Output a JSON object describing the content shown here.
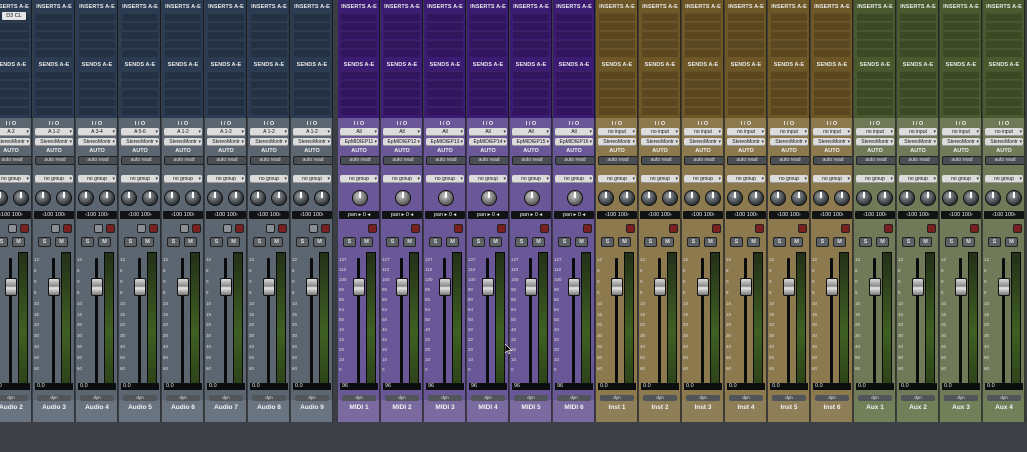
{
  "labels": {
    "inserts": "INSERTS A-E",
    "sends": "SENDS A-E",
    "io": "I / O",
    "auto": "AUTO",
    "auto_read": "auto read",
    "no_group": "no group",
    "solo": "S",
    "mute": "M",
    "pan_audio": "‹100 100›",
    "pan_midi": "pan ▸ 0 ◂",
    "no_input": "no input",
    "stereo_output": "StereoMontr",
    "dyn": "dyn",
    "selected_insert": "D3 CL"
  },
  "groups": [
    {
      "type": "audio",
      "color": "#2b3c52"
    },
    {
      "type": "midi",
      "color": "#3d1b72"
    },
    {
      "type": "inst",
      "color": "#6e5727"
    },
    {
      "type": "aux",
      "color": "#4a5a2e"
    }
  ],
  "strips": [
    {
      "name": "Audio 2",
      "type": "audio",
      "input": "A 2",
      "volume": "0.0"
    },
    {
      "name": "Audio 3",
      "type": "audio",
      "input": "A 1-2",
      "volume": "0.0"
    },
    {
      "name": "Audio 4",
      "type": "audio",
      "input": "A 3-4",
      "volume": "0.0"
    },
    {
      "name": "Audio 5",
      "type": "audio",
      "input": "A 5-6",
      "volume": "0.0"
    },
    {
      "name": "Audio 6",
      "type": "audio",
      "input": "A 1-2",
      "volume": "0.0"
    },
    {
      "name": "Audio 7",
      "type": "audio",
      "input": "A 1-2",
      "volume": "0.0"
    },
    {
      "name": "Audio 8",
      "type": "audio",
      "input": "A 1-2",
      "volume": "0.0"
    },
    {
      "name": "Audio 9",
      "type": "audio",
      "input": "A 1-2",
      "volume": "0.0"
    },
    {
      "name": "MIDI 1",
      "type": "midi",
      "input": "All",
      "output": "EpMIDIEP11",
      "volume": "96"
    },
    {
      "name": "MIDI 2",
      "type": "midi",
      "input": "All",
      "output": "EpMIDIEP12",
      "volume": "96"
    },
    {
      "name": "MIDI 3",
      "type": "midi",
      "input": "All",
      "output": "EpMIDIEP13",
      "volume": "96"
    },
    {
      "name": "MIDI 4",
      "type": "midi",
      "input": "All",
      "output": "EpMIDIEP14",
      "volume": "96"
    },
    {
      "name": "MIDI 5",
      "type": "midi",
      "input": "All",
      "output": "EpMIDIEP15",
      "volume": "96"
    },
    {
      "name": "MIDI 6",
      "type": "midi",
      "input": "All",
      "output": "EpMIDIEP16",
      "volume": "96"
    },
    {
      "name": "Inst 1",
      "type": "inst",
      "input": "no input",
      "volume": "0.0"
    },
    {
      "name": "Inst 2",
      "type": "inst",
      "input": "no input",
      "volume": "0.0"
    },
    {
      "name": "Inst 3",
      "type": "inst",
      "input": "no input",
      "volume": "0.0"
    },
    {
      "name": "Inst 4",
      "type": "inst",
      "input": "no input",
      "volume": "0.0"
    },
    {
      "name": "Inst 5",
      "type": "inst",
      "input": "no input",
      "volume": "0.0"
    },
    {
      "name": "Inst 6",
      "type": "inst",
      "input": "no input",
      "volume": "0.0"
    },
    {
      "name": "Aux 1",
      "type": "aux",
      "input": "no input",
      "volume": "0.0"
    },
    {
      "name": "Aux 2",
      "type": "aux",
      "input": "no input",
      "volume": "0.0"
    },
    {
      "name": "Aux 3",
      "type": "aux",
      "input": "no input",
      "volume": "0.0"
    },
    {
      "name": "Aux 4",
      "type": "aux",
      "input": "no input",
      "volume": "0.0"
    }
  ],
  "meter_scale_audio": [
    "12",
    "6",
    "0",
    "5",
    "10",
    "15",
    "20",
    "30",
    "40",
    "50",
    "60"
  ],
  "meter_scale_midi": [
    "127",
    "110",
    "100",
    "90",
    "80",
    "64",
    "50",
    "40",
    "32",
    "20",
    "10",
    "0"
  ]
}
